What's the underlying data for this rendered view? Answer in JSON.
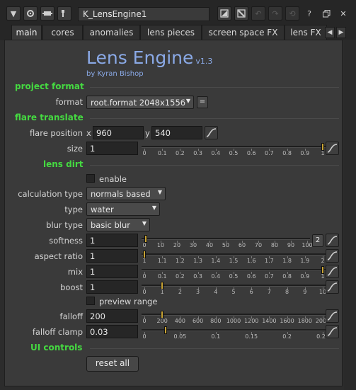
{
  "window": {
    "node_name": "K_LensEngine1",
    "colors": {
      "accent_green": "#45d941",
      "title_blue": "#8aa9e6",
      "slider_handle": "#c9a434"
    }
  },
  "titlebar": {
    "icons": [
      "collapse-arrow-icon",
      "settings-gear-icon",
      "node-icon",
      "wrench-icon",
      "knob-toggle-icon",
      "knob-toggle-alt-icon",
      "undo-icon",
      "redo-icon",
      "revert-icon",
      "help-icon",
      "float-panel-icon",
      "close-icon"
    ]
  },
  "tabs": [
    "main",
    "cores",
    "anomalies",
    "lens pieces",
    "screen space FX",
    "lens FX"
  ],
  "header": {
    "title": "Lens Engine",
    "version": "v1.3",
    "author": "by Kyran Bishop"
  },
  "sections": {
    "project_format": "project format",
    "flare_translate": "flare translate",
    "lens_dirt": "lens dirt",
    "ui_controls": "UI controls"
  },
  "project_format": {
    "format_label": "format",
    "format_value": "root.format 2048x1556",
    "equals_label": "="
  },
  "flare_translate": {
    "position_label": "flare position",
    "x_label": "x",
    "x_value": "960",
    "y_label": "y",
    "y_value": "540",
    "size_label": "size",
    "size_value": "1"
  },
  "lens_dirt": {
    "enable_label": "enable",
    "calc_label": "calculation type",
    "calc_value": "normals based",
    "type_label": "type",
    "type_value": "water",
    "blur_label": "blur type",
    "blur_value": "basic blur",
    "softness_label": "softness",
    "softness_value": "1",
    "softness_channels": "2",
    "aspect_label": "aspect ratio",
    "aspect_value": "1",
    "mix_label": "mix",
    "mix_value": "1",
    "boost_label": "boost",
    "boost_value": "1",
    "preview_label": "preview range",
    "falloff_label": "falloff",
    "falloff_value": "200",
    "clamp_label": "falloff clamp",
    "clamp_value": "0.03"
  },
  "ui_controls": {
    "reset_label": "reset all"
  },
  "sliders": {
    "size": {
      "ticks": [
        "0",
        "0.1",
        "0.2",
        "0.3",
        "0.4",
        "0.5",
        "0.6",
        "0.7",
        "0.8",
        "0.9",
        "1"
      ],
      "min": 0,
      "max": 1,
      "value": 1
    },
    "softness": {
      "ticks": [
        "0",
        "10",
        "20",
        "30",
        "40",
        "50",
        "60",
        "70",
        "80",
        "90",
        "100"
      ],
      "min": 0,
      "max": 100,
      "value": 1
    },
    "aspect": {
      "ticks": [
        "1",
        "1.1",
        "1.2",
        "1.3",
        "1.4",
        "1.5",
        "1.6",
        "1.7",
        "1.8",
        "1.9",
        "2"
      ],
      "min": 1,
      "max": 2,
      "value": 1
    },
    "mix": {
      "ticks": [
        "0",
        "0.1",
        "0.2",
        "0.3",
        "0.4",
        "0.5",
        "0.6",
        "0.7",
        "0.8",
        "0.9",
        "1"
      ],
      "min": 0,
      "max": 1,
      "value": 1
    },
    "boost": {
      "ticks": [
        "0",
        "1",
        "2",
        "3",
        "4",
        "5",
        "6",
        "7",
        "8",
        "9",
        "10"
      ],
      "min": 0,
      "max": 10,
      "value": 1
    },
    "falloff": {
      "ticks": [
        "0",
        "200",
        "400",
        "600",
        "800",
        "1000",
        "1200",
        "1400",
        "1600",
        "1800",
        "2000"
      ],
      "min": 0,
      "max": 2000,
      "value": 200
    },
    "clamp": {
      "ticks": [
        "0",
        "0.05",
        "0.1",
        "0.15",
        "0.2",
        "0.25"
      ],
      "min": 0,
      "max": 0.25,
      "value": 0.03
    }
  }
}
